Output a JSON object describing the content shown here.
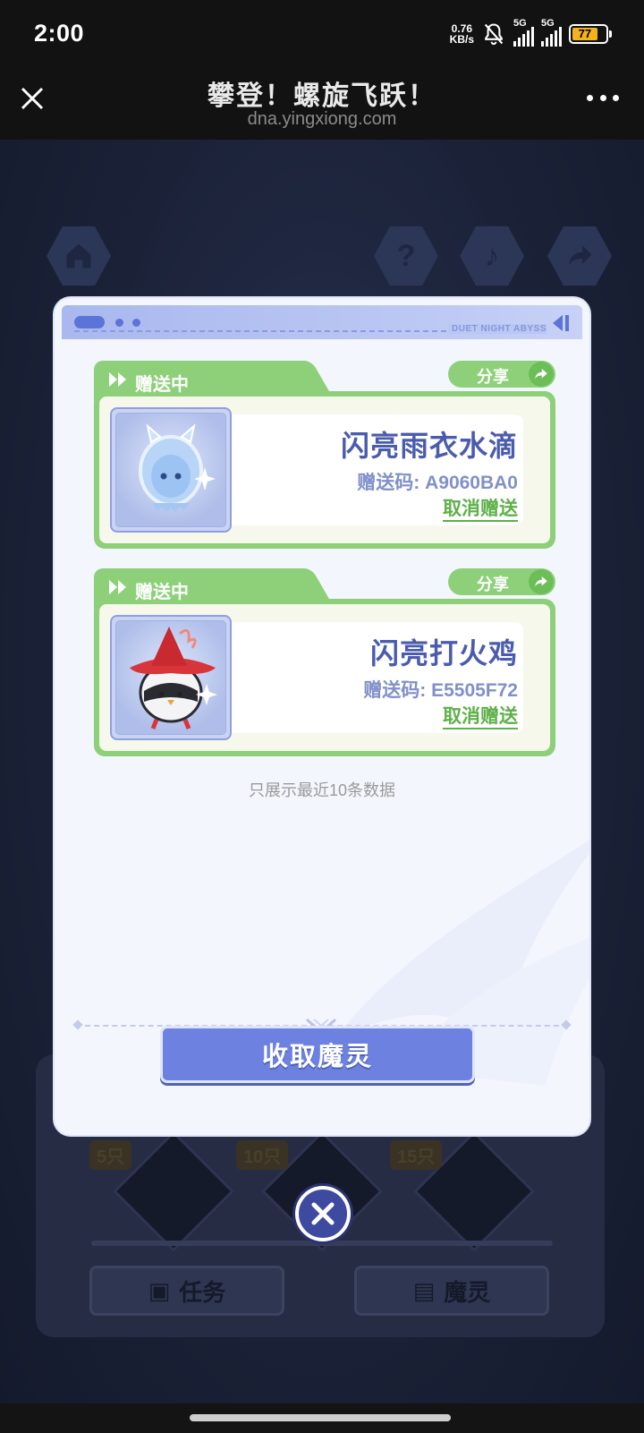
{
  "status_bar": {
    "time": "2:00",
    "net_speed_value": "0.76",
    "net_speed_unit": "KB/s",
    "sim1": "5G",
    "sim2": "5G",
    "battery": "77"
  },
  "title_bar": {
    "title": "攀登！螺旋飞跃！",
    "url": "dna.yingxiong.com"
  },
  "modal": {
    "brand": "DUET NIGHT ABYSS",
    "gifts": [
      {
        "status": "赠送中",
        "share_label": "分享",
        "name": "闪亮雨衣水滴",
        "code": "赠送码: A9060BA0",
        "cancel_label": "取消赠送"
      },
      {
        "status": "赠送中",
        "share_label": "分享",
        "name": "闪亮打火鸡",
        "code": "赠送码: E5505F72",
        "cancel_label": "取消赠送"
      }
    ],
    "note": "只展示最近10条数据",
    "collect_label": "收取魔灵"
  },
  "background": {
    "counts": [
      "5只",
      "10只",
      "15只"
    ],
    "task_label": "任务",
    "spirit_label": "魔灵"
  },
  "colors": {
    "accent_blue": "#6d82e0",
    "accent_green": "#8ed07a",
    "title_text": "#4b5cae"
  }
}
